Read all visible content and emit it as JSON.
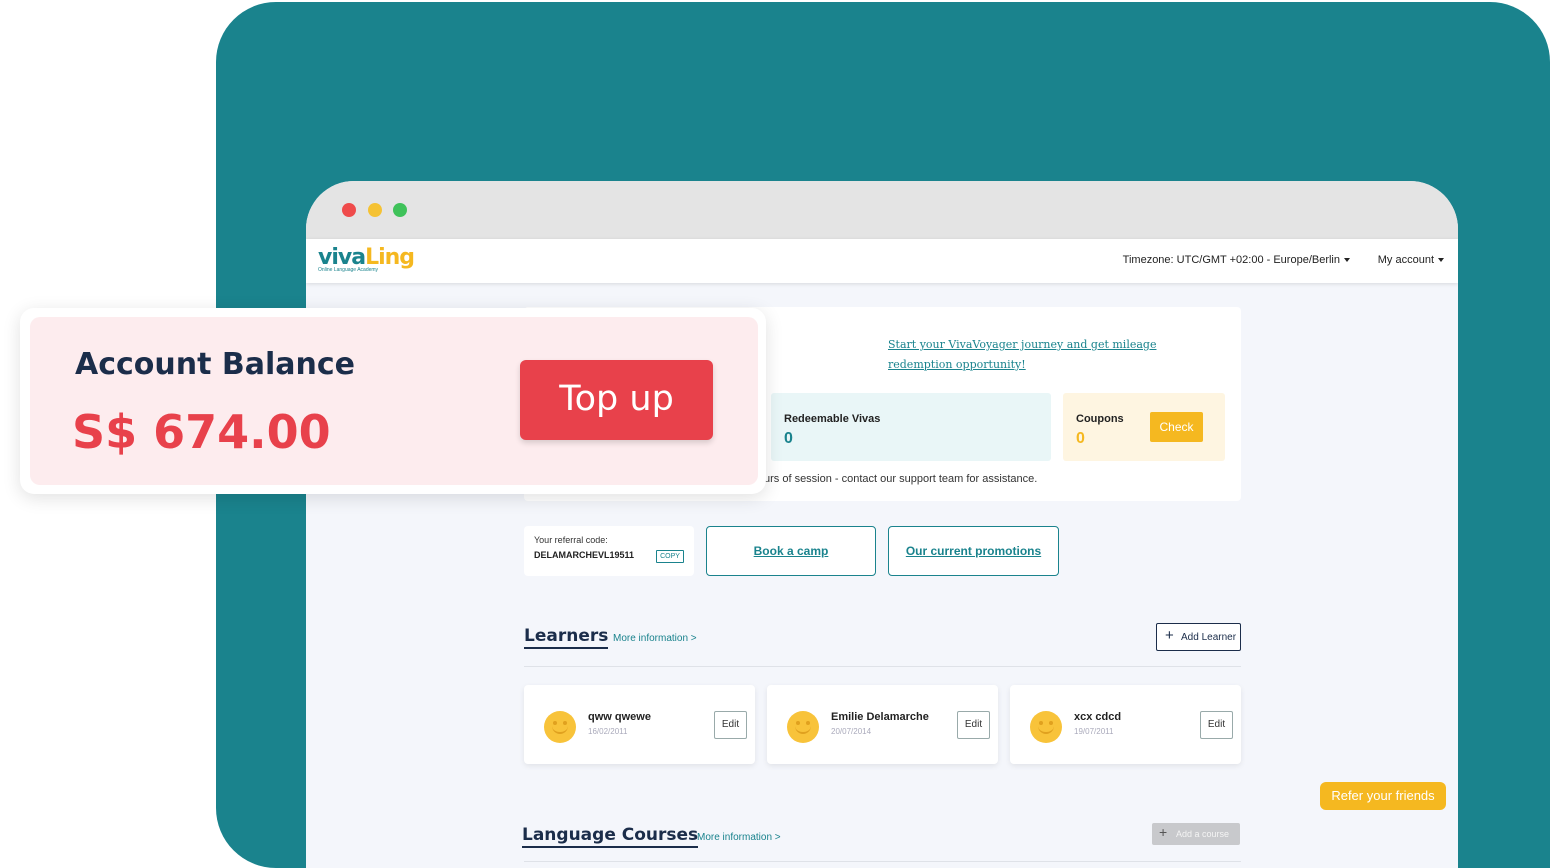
{
  "header": {
    "logo_main_1": "viva",
    "logo_main_2": "Ling",
    "logo_sub": "Online Language Academy",
    "timezone": "Timezone: UTC/GMT +02:00 - Europe/Berlin",
    "account": "My account"
  },
  "promo": {
    "voyager_link": "Start your VivaVoyager journey and get mileage redemption opportunity!"
  },
  "vivas": {
    "label": "Redeemable Vivas",
    "value": "0"
  },
  "coupons": {
    "label": "Coupons",
    "value": "0",
    "check_label": "Check"
  },
  "support_text": "urs of session - contact our support team for assistance.",
  "referral": {
    "label": "Your referral code:",
    "code": "DELAMARCHEVL19511",
    "copy_label": "COPY"
  },
  "actions": {
    "book_camp": "Book a camp",
    "promotions": "Our current promotions"
  },
  "learners": {
    "title": "Learners",
    "more": "More information >",
    "add_label": "Add Learner",
    "items": [
      {
        "name": "qww qwewe",
        "date": "16/02/2011",
        "edit": "Edit"
      },
      {
        "name": "Emilie Delamarche",
        "date": "20/07/2014",
        "edit": "Edit"
      },
      {
        "name": "xcx cdcd",
        "date": "19/07/2011",
        "edit": "Edit"
      }
    ]
  },
  "courses": {
    "title": "Language Courses",
    "more": "More information >",
    "add_label": "Add a course"
  },
  "refer": {
    "label": "Refer your friends"
  },
  "balance": {
    "title": "Account Balance",
    "value": "S$ 674.00",
    "topup_label": "Top up"
  },
  "colors": {
    "teal": "#1a838d",
    "yellow": "#f5b820",
    "red": "#e8414b",
    "navy": "#1b2d4a"
  }
}
